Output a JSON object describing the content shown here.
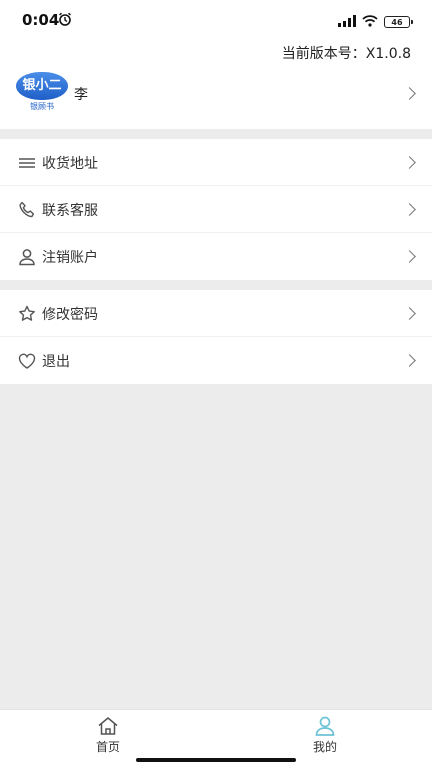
{
  "status_bar": {
    "time": "0:04",
    "battery": "46"
  },
  "header": {
    "version_text": "当前版本号：X1.0.8"
  },
  "profile": {
    "avatar_text": "银小二",
    "avatar_subtext": "银顾书",
    "name": "李"
  },
  "menu_group_1": [
    {
      "label": "收货地址",
      "icon": "menu-lines-icon"
    },
    {
      "label": "联系客服",
      "icon": "phone-icon"
    },
    {
      "label": "注销账户",
      "icon": "user-icon"
    }
  ],
  "menu_group_2": [
    {
      "label": "修改密码",
      "icon": "star-icon"
    },
    {
      "label": "退出",
      "icon": "heart-icon"
    }
  ],
  "tabbar": {
    "home_label": "首页",
    "mine_label": "我的",
    "active": "mine",
    "active_color": "#6cc3d5"
  }
}
